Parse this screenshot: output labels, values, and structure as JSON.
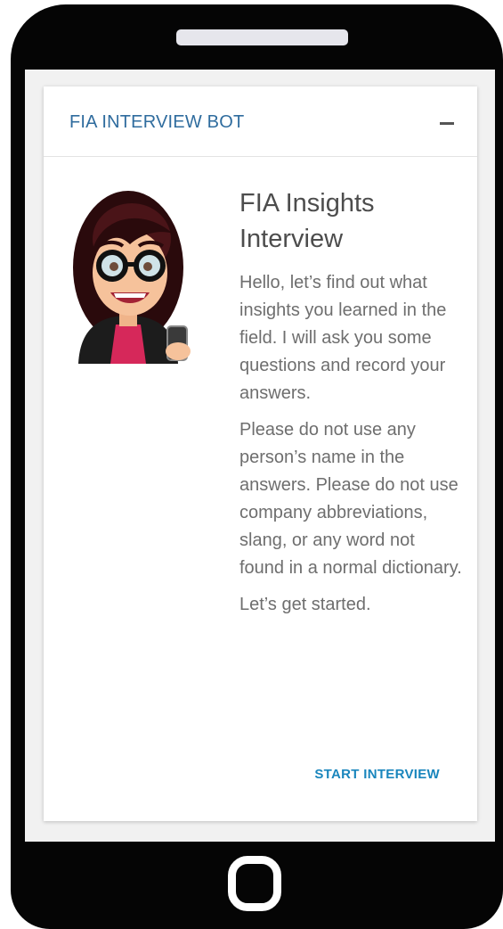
{
  "card": {
    "title": "FIA INTERVIEW BOT",
    "collapse_icon": "minus-icon"
  },
  "content": {
    "headline": "FIA Insights Interview",
    "paragraphs": [
      "Hello, let’s find out what insights you learned in the field. I will ask you some questions and record your answers.",
      "Please do not use any person’s name in the answers. Please do not use company abbreviations, slang, or any word not found in a normal dictionary.",
      "Let’s get started."
    ]
  },
  "actions": {
    "start_label": "START INTERVIEW"
  },
  "colors": {
    "title": "#2f6c9e",
    "action": "#1a86bd",
    "phone_body": "#050505",
    "screen_bg": "#f1f1f1"
  }
}
